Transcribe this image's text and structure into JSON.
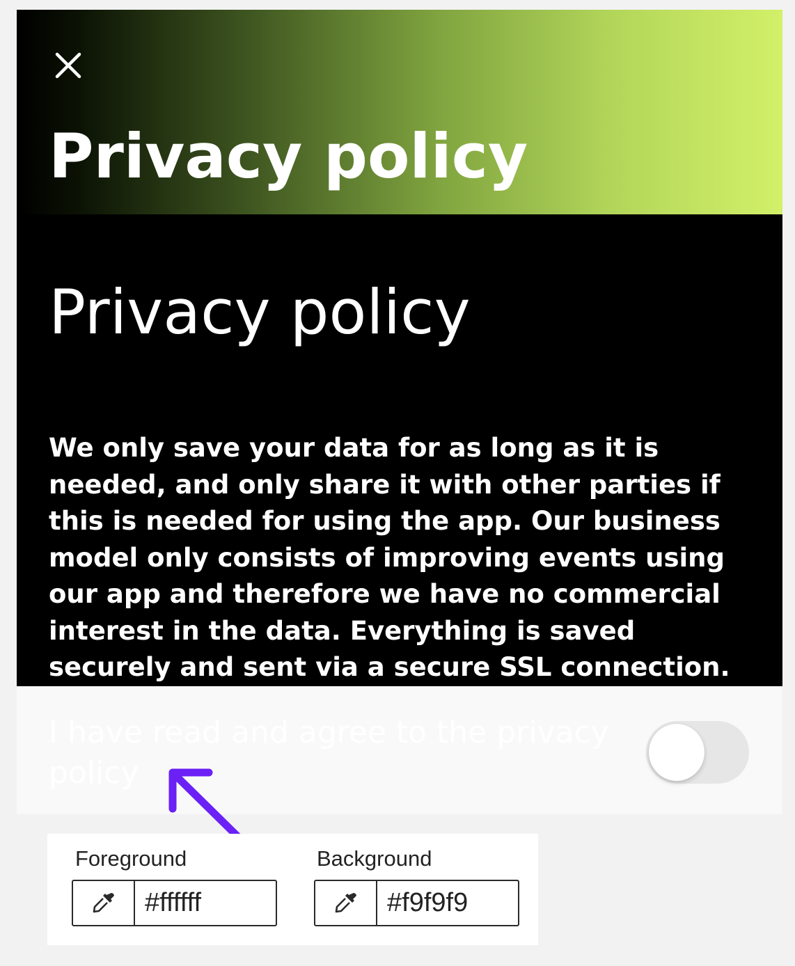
{
  "header": {
    "close_icon": "close-icon",
    "title": "Privacy policy",
    "gradient_colors": [
      "#000000",
      "#d2f068"
    ]
  },
  "content": {
    "heading": "Privacy policy",
    "body": "We only save your data for as long as it is needed, and only share it with other parties if this is needed for using the app. Our business model only consists of improving events using our app and therefore we have no commercial interest in the data. Everything is saved securely and sent via a secure SSL connection."
  },
  "agreement": {
    "label": "I have read and agree to the privacy policy",
    "toggle_on": false
  },
  "annotation": {
    "arrow_color": "#6b21f5"
  },
  "color_check": {
    "foreground": {
      "label": "Foreground",
      "value": "#ffffff",
      "icon": "eyedropper-icon"
    },
    "background": {
      "label": "Background",
      "value": "#f9f9f9",
      "icon": "eyedropper-icon"
    }
  }
}
